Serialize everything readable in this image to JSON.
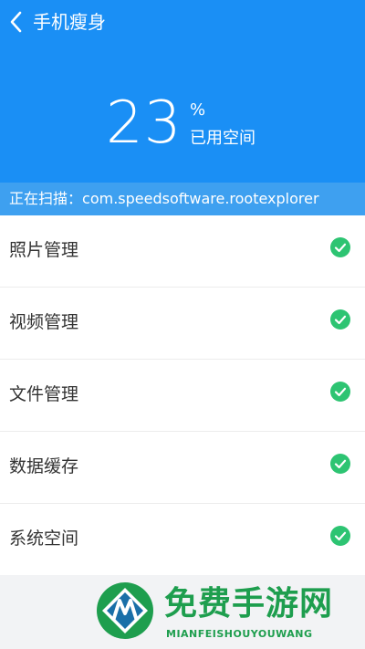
{
  "header": {
    "title": "手机瘦身",
    "usage_value": "23",
    "usage_unit": "%",
    "usage_label": "已用空间",
    "accent_color": "#1a8ff5"
  },
  "scan": {
    "label": "正在扫描：",
    "package": "com.speedsoftware.rootexplorer"
  },
  "items": [
    {
      "label": "照片管理",
      "icon": "check-circle-icon",
      "status_color": "#2dc472"
    },
    {
      "label": "视频管理",
      "icon": "check-circle-icon",
      "status_color": "#2dc472"
    },
    {
      "label": "文件管理",
      "icon": "check-circle-icon",
      "status_color": "#2dc472"
    },
    {
      "label": "数据缓存",
      "icon": "check-circle-icon",
      "status_color": "#2dc472"
    },
    {
      "label": "系统空间",
      "icon": "check-circle-icon",
      "status_color": "#2dc472"
    }
  ],
  "watermark": {
    "cn": "免费手游网",
    "en": "MIANFEISHOUYOUWANG"
  }
}
